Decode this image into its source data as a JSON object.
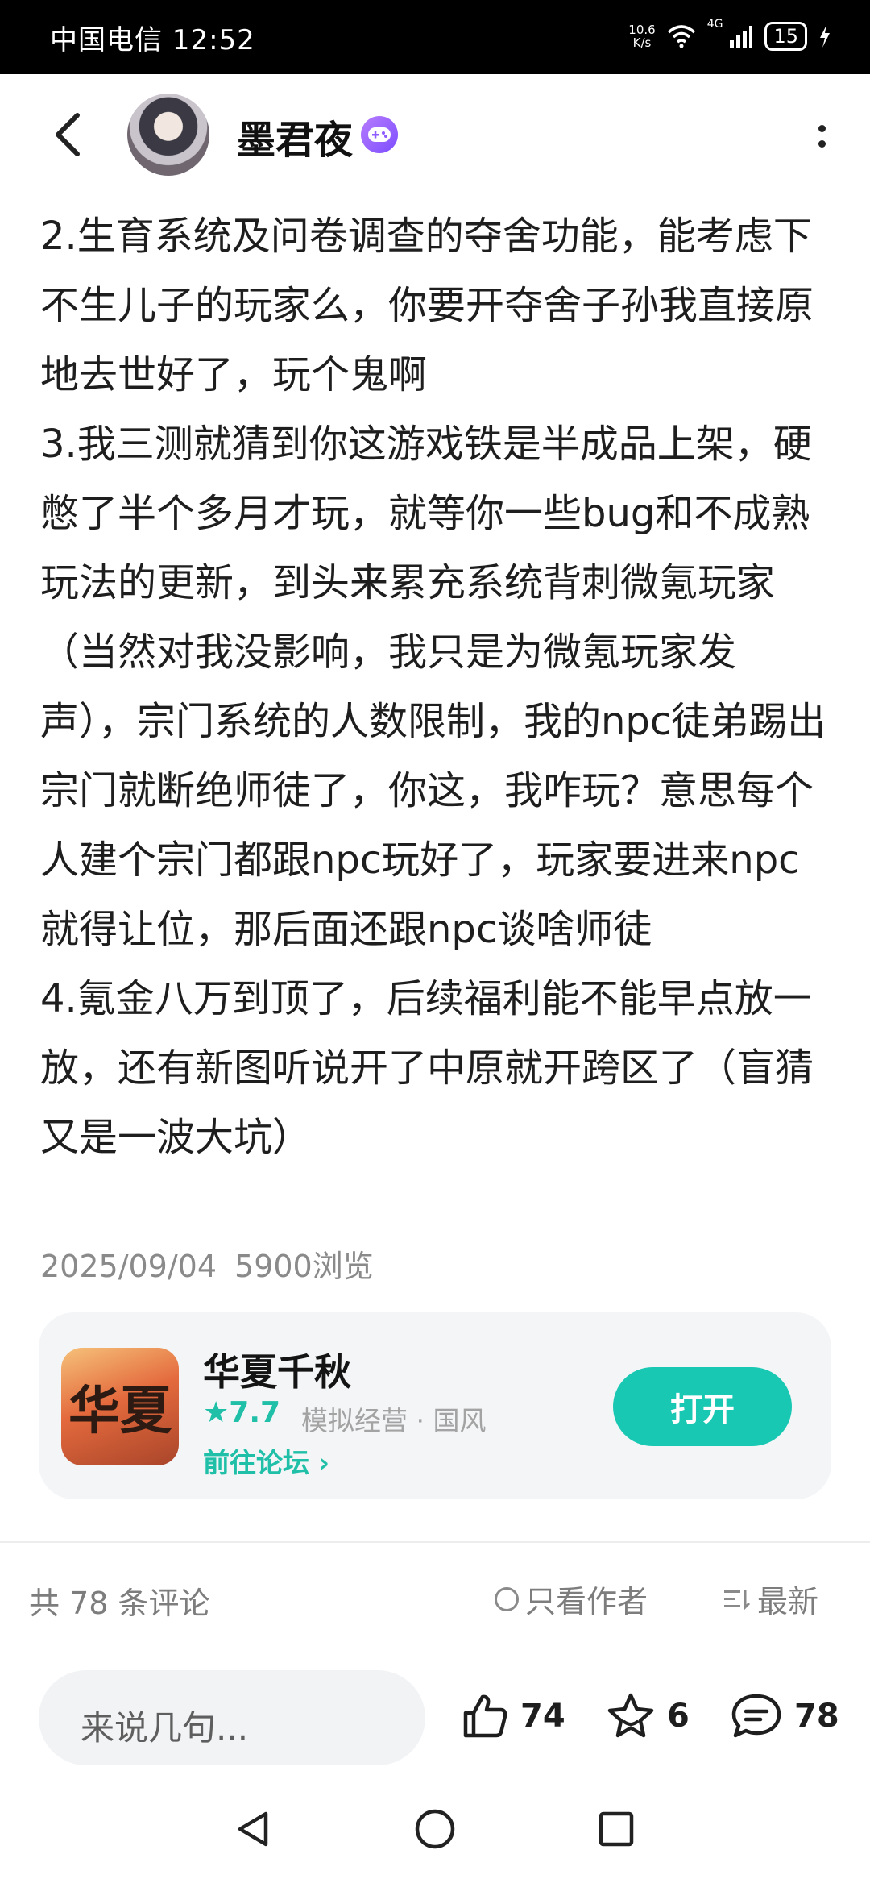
{
  "status_bar": {
    "carrier_time": "中国电信 12:52",
    "net_speed_value": "10.6",
    "net_speed_unit": "K/s",
    "network_type": "4G",
    "battery": "15"
  },
  "header": {
    "author_name": "墨君夜",
    "icons": [
      "back-arrow-icon",
      "avatar",
      "gamepad-badge-icon",
      "more-vertical-icon"
    ]
  },
  "post": {
    "paragraphs": [
      "2.生育系统及问卷调查的夺舍功能，能考虑下不生儿子的玩家么，你要开夺舍子孙我直接原地去世好了，玩个鬼啊",
      "3.我三测就猜到你这游戏铁是半成品上架，硬憋了半个多月才玩，就等你一些bug和不成熟玩法的更新，到头来累充系统背刺微氪玩家（当然对我没影响，我只是为微氪玩家发声），宗门系统的人数限制，我的npc徒弟踢出宗门就断绝师徒了，你这，我咋玩？意思每个人建个宗门都跟npc玩好了，玩家要进来npc就得让位，那后面还跟npc谈啥师徒",
      "4.氪金八万到顶了，后续福利能不能早点放一放，还有新图听说开了中原就开跨区了（盲猜又是一波大坑）"
    ],
    "date": "2025/09/04",
    "views": "5900浏览"
  },
  "game_card": {
    "title": "华夏千秋",
    "rating": "★7.7",
    "tags": "模拟经营 · 国风",
    "forum_link": "前往论坛 ›",
    "open_label": "打开",
    "icon_text": "华夏"
  },
  "comments_bar": {
    "count_label": "共 78 条评论",
    "author_only_label": "只看作者",
    "sort_label": "最新"
  },
  "bottom_bar": {
    "input_placeholder": "来说几句...",
    "likes": "74",
    "favorites": "6",
    "comments": "78"
  },
  "colors": {
    "accent": "#19c8b3",
    "badge": "#8e5cff"
  }
}
